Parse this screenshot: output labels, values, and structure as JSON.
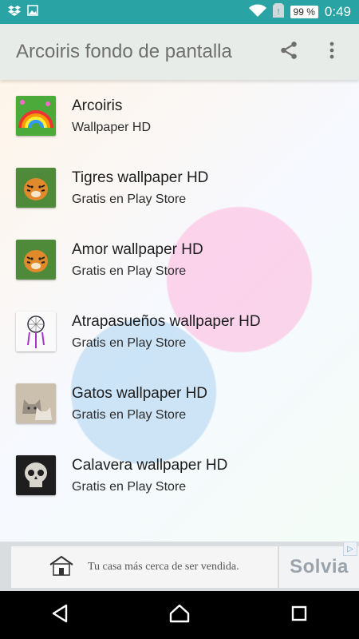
{
  "status_bar": {
    "battery": "99 %",
    "time": "0:49",
    "icons": [
      "dropbox-icon",
      "image-icon",
      "wifi-icon",
      "sim-icon",
      "battery-icon"
    ]
  },
  "app_bar": {
    "title": "Arcoiris fondo de pantalla",
    "actions": [
      "share-icon",
      "more-vert-icon"
    ]
  },
  "list": [
    {
      "title": "Arcoiris",
      "subtitle": "Wallpaper HD",
      "thumb": "rainbow-thumb"
    },
    {
      "title": "Tigres wallpaper HD",
      "subtitle": "Gratis en Play Store",
      "thumb": "tiger-thumb"
    },
    {
      "title": "Amor wallpaper HD",
      "subtitle": "Gratis en Play Store",
      "thumb": "tiger-thumb"
    },
    {
      "title": "Atrapasueños wallpaper HD",
      "subtitle": "Gratis en Play Store",
      "thumb": "dreamcatcher-thumb"
    },
    {
      "title": "Gatos wallpaper HD",
      "subtitle": "Gratis en Play Store",
      "thumb": "cats-thumb"
    },
    {
      "title": "Calavera wallpaper HD",
      "subtitle": "Gratis en Play Store",
      "thumb": "skull-thumb"
    }
  ],
  "ad": {
    "text": "Tu casa más cerca de ser vendida.",
    "brand": "Solvia",
    "choice": "▷"
  },
  "nav": [
    "back-icon",
    "home-icon",
    "recents-icon"
  ]
}
